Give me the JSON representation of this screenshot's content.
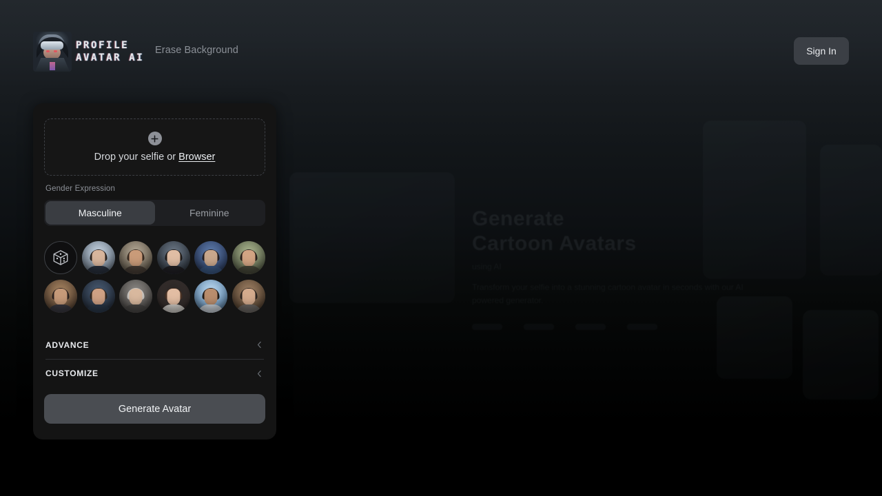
{
  "header": {
    "logo_line1": "PROFILE",
    "logo_line2": "AVATAR AI",
    "logo_icon": "vr-avatar-logo",
    "nav_erase_background": "Erase Background",
    "sign_in": "Sign In"
  },
  "background_hero": {
    "title": "Generate\nCartoon Avatars",
    "title_line1": "Generate",
    "title_line2": "Cartoon Avatars",
    "subtitle": "using AI",
    "body": "Transform your selfie into a stunning cartoon avatar in seconds with our AI powered generator."
  },
  "panel": {
    "upload": {
      "icon": "plus-icon",
      "text_prefix": "Drop your selfie or ",
      "browse_label": "Browser"
    },
    "gender": {
      "label": "Gender Expression",
      "options": [
        "Masculine",
        "Feminine"
      ],
      "selected": "Masculine"
    },
    "styles": {
      "random_icon": "dice-cube-icon",
      "items": [
        {
          "name": "style-random",
          "type": "dice"
        },
        {
          "name": "style-1",
          "skin": "#d8b59c",
          "hair": "#2c2420",
          "cloth": "#2b3340",
          "bg": "#b9c6d4"
        },
        {
          "name": "style-2",
          "skin": "#c99b79",
          "hair": "#3a2c22",
          "cloth": "#4a4038",
          "bg": "#9d9282"
        },
        {
          "name": "style-3",
          "skin": "#e0bda4",
          "hair": "#201c1a",
          "cloth": "#232227",
          "bg": "#55606d"
        },
        {
          "name": "style-4",
          "skin": "#c9a78c",
          "hair": "#262024",
          "cloth": "#3c5a86",
          "bg": "#3f5d8c"
        },
        {
          "name": "style-5",
          "skin": "#d2a483",
          "hair": "#2a211c",
          "cloth": "#4a4b3c",
          "bg": "#8e9a78"
        },
        {
          "name": "style-6",
          "skin": "#c69a79",
          "hair": "#2d2320",
          "cloth": "#3b3a42",
          "bg": "#8a6f54"
        },
        {
          "name": "style-7",
          "skin": "#cfa184",
          "hair": "#352a22",
          "cloth": "#2c3a4c",
          "bg": "#36465c"
        },
        {
          "name": "style-8",
          "skin": "#d8b89e",
          "hair": "#c9c6c2",
          "cloth": "#4c4a48",
          "bg": "#6d6a66"
        },
        {
          "name": "style-9",
          "skin": "#e2bda3",
          "hair": "#4a3326",
          "cloth": "#d8d5d0",
          "bg": "#3a3230"
        },
        {
          "name": "style-10",
          "skin": "#b98d6d",
          "hair": "#241d19",
          "cloth": "#cfd6dd",
          "bg": "#93b6d6"
        },
        {
          "name": "style-11",
          "skin": "#d4ab8d",
          "hair": "#2e2621",
          "cloth": "#6e6a66",
          "bg": "#7b6652"
        }
      ]
    },
    "sections": [
      {
        "title": "ADVANCE",
        "icon": "chevron-left-icon",
        "expanded": false
      },
      {
        "title": "CUSTOMIZE",
        "icon": "chevron-left-icon",
        "expanded": false
      }
    ],
    "generate_label": "Generate Avatar"
  },
  "colors": {
    "panel_bg": "#141414",
    "page_top": "#23282d",
    "page_bottom": "#000000",
    "accent_btn": "#4a4d52",
    "signin_btn": "#3b3f45",
    "seg_active": "#3a3d42"
  }
}
